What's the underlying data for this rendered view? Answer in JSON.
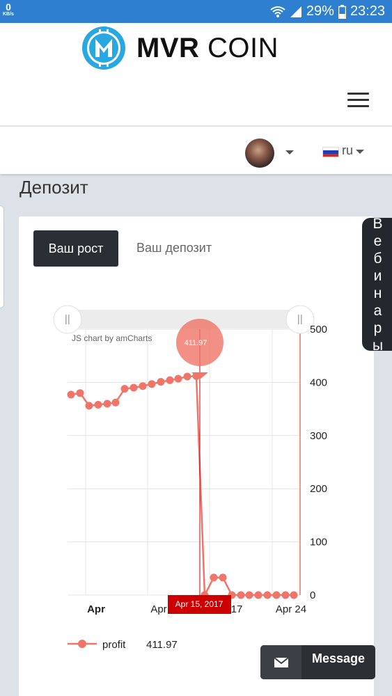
{
  "status_bar": {
    "net_speed": "0",
    "net_unit": "KB/s",
    "battery": "29%",
    "time": "23:23"
  },
  "header": {
    "logo_bold": "MVR",
    "logo_regular": " COIN",
    "menu_icon": "hamburger-icon"
  },
  "user": {
    "avatar_icon": "avatar",
    "language": "ru"
  },
  "page": {
    "title": "Депозит"
  },
  "tabs": [
    {
      "label": "Ваш рост",
      "active": true
    },
    {
      "label": "Ваш депозит",
      "active": false
    }
  ],
  "webinar": {
    "label": "Вебинары"
  },
  "message": {
    "label": "Message",
    "icon": "envelope-icon"
  },
  "chart_data": {
    "type": "line",
    "credit": "JS chart by amCharts",
    "x_labels": [
      "Apr",
      "Apr",
      "17",
      "Apr 24"
    ],
    "y_ticks": [
      0,
      100,
      200,
      300,
      400,
      500
    ],
    "ylim": [
      0,
      500
    ],
    "series": [
      {
        "name": "profit",
        "color": "#f07468",
        "values": [
          377,
          380,
          356,
          358,
          360,
          362,
          388,
          390,
          393,
          397,
          401,
          404,
          407,
          411,
          411.97,
          0,
          33,
          33,
          0,
          0,
          0,
          0,
          0,
          0,
          0,
          0,
          0
        ]
      }
    ],
    "cursor": {
      "date_label": "Apr 15, 2017",
      "value_label": "411.97"
    },
    "legend": {
      "label": "profit",
      "value": "411.97"
    }
  }
}
